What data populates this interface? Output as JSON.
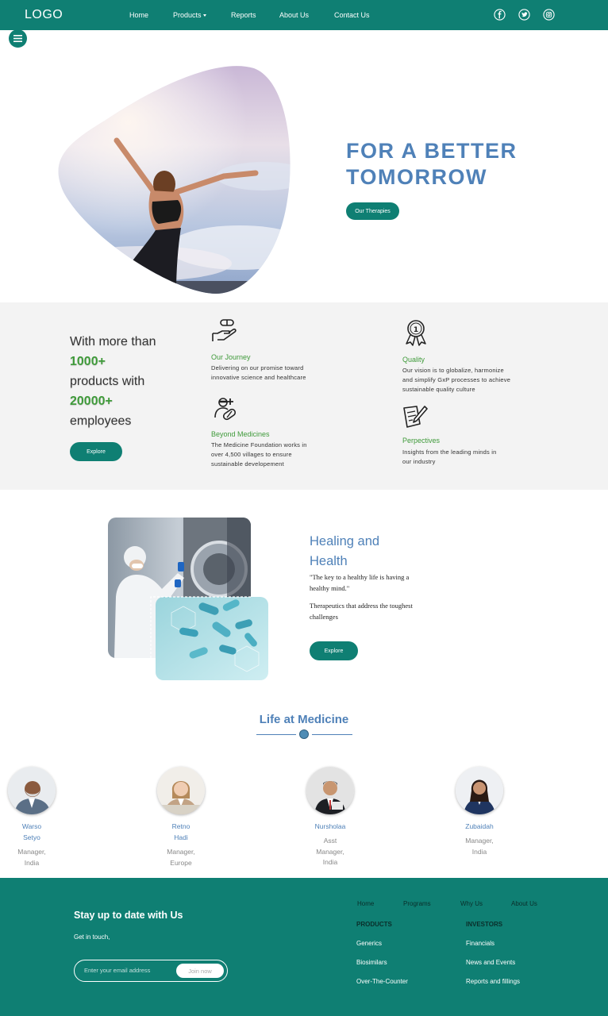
{
  "nav": {
    "logo": "LOGO",
    "links": [
      "Home",
      "Products",
      "Reports",
      "About Us",
      "Contact Us"
    ]
  },
  "hero": {
    "title_line1": "FOR A BETTER",
    "title_line2": "TOMORROW",
    "button": "Our Therapies"
  },
  "stats": {
    "line1": "With more than",
    "count1": "1000+",
    "line2": "products with",
    "count2": "20000+",
    "line3": "employees",
    "button": "Explore",
    "features": [
      {
        "title": "Our Journey",
        "desc_1": "Delivering on our promise toward",
        "desc_2": "innovative science and healthcare",
        "icon": "hand-pill-icon"
      },
      {
        "title": "Quality",
        "desc_1": "Our vision is to globalize, harmonize",
        "desc_2": "and simplify GxP processes to achieve",
        "desc_3": "sustainable quality culture",
        "icon": "award-icon"
      },
      {
        "title": "Beyond Medicines",
        "desc_1": "The Medicine Foundation works in",
        "desc_2": "over 4,500 villages to ensure",
        "desc_3": "sustainable developement",
        "icon": "doctor-pill-icon"
      },
      {
        "title": "Perpectives",
        "desc_1": "Insights from the leading minds in",
        "desc_2": "our industry",
        "icon": "document-pen-icon"
      }
    ]
  },
  "healing": {
    "title_1": "Healing and",
    "title_2": "Health",
    "quote_1": "\"The key to a healthy life is having a",
    "quote_2": "healthy mind.\"",
    "sub_1": "Therapeutics that address the toughest",
    "sub_2": "challenges",
    "button": "Explore"
  },
  "life": {
    "title": "Life at Medicine",
    "people": [
      {
        "name_1": "Warso",
        "name_2": "Setyo",
        "role_1": "Manager,",
        "role_2": "India"
      },
      {
        "name_1": "Retno",
        "name_2": "Hadi",
        "role_1": "Manager,",
        "role_2": "Europe"
      },
      {
        "name_1": "Nursholaa",
        "role_1": "Asst",
        "role_2": "Manager,",
        "role_3": "India"
      },
      {
        "name_1": "Zubaidah",
        "role_1": "Manager,",
        "role_2": "India"
      }
    ]
  },
  "footer": {
    "title": "Stay up to date with Us",
    "subtitle": "Get in touch,",
    "email_placeholder": "Enter your email address",
    "join": "Join now",
    "nav": [
      "Home",
      "Programs",
      "Why Us",
      "About Us"
    ],
    "products_head": "PRODUCTS",
    "products": [
      "Generics",
      "Biosimilars",
      "Over-The-Counter"
    ],
    "investors_head": "INVESTORS",
    "investors": [
      "Financials",
      "News and Events",
      "Reports and fillings"
    ]
  },
  "colors": {
    "primary": "#0f7f73",
    "heading_blue": "#4f81b8",
    "green": "#3f9a3a",
    "section_bg": "#f3f3f3"
  }
}
